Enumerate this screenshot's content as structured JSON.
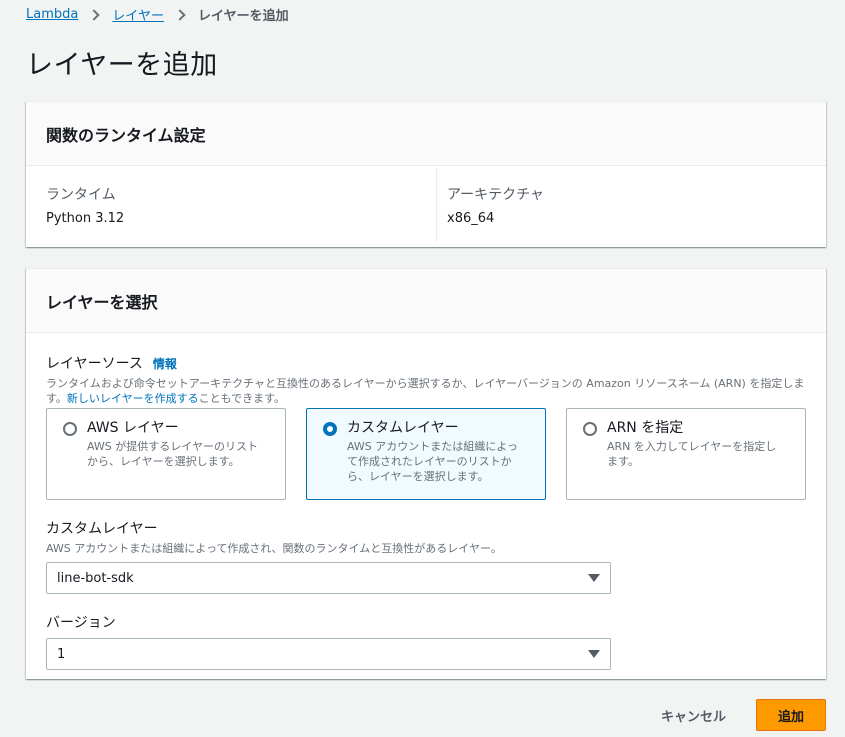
{
  "breadcrumb": {
    "items": [
      "Lambda",
      "レイヤー"
    ],
    "current": "レイヤーを追加"
  },
  "page_title": "レイヤーを追加",
  "runtime_settings": {
    "title": "関数のランタイム設定",
    "runtime_label": "ランタイム",
    "runtime_value": "Python 3.12",
    "arch_label": "アーキテクチャ",
    "arch_value": "x86_64"
  },
  "layer_select": {
    "title": "レイヤーを選択",
    "source_label": "レイヤーソース",
    "info_link": "情報",
    "source_desc_1": "ランタイムおよび命令セットアーキテクチャと互換性のあるレイヤーから選択するか、レイヤーバージョンの Amazon リソースネーム (ARN) を指定します。",
    "source_desc_link": "新しいレイヤーを作成する",
    "source_desc_2": "こともできます。",
    "options": [
      {
        "title": "AWS レイヤー",
        "desc": "AWS が提供するレイヤーのリストから、レイヤーを選択します。",
        "selected": false
      },
      {
        "title": "カスタムレイヤー",
        "desc": "AWS アカウントまたは組織によって作成されたレイヤーのリストから、レイヤーを選択します。",
        "selected": true
      },
      {
        "title": "ARN を指定",
        "desc": "ARN を入力してレイヤーを指定します。",
        "selected": false
      }
    ],
    "custom_layer_label": "カスタムレイヤー",
    "custom_layer_desc": "AWS アカウントまたは組織によって作成され、関数のランタイムと互換性があるレイヤー。",
    "custom_layer_value": "line-bot-sdk",
    "version_label": "バージョン",
    "version_value": "1"
  },
  "footer": {
    "cancel_label": "キャンセル",
    "add_label": "追加"
  },
  "colors": {
    "accent": "#0073bb",
    "primary_button": "#ff9900",
    "selected_tile_bg": "#f1faff"
  }
}
